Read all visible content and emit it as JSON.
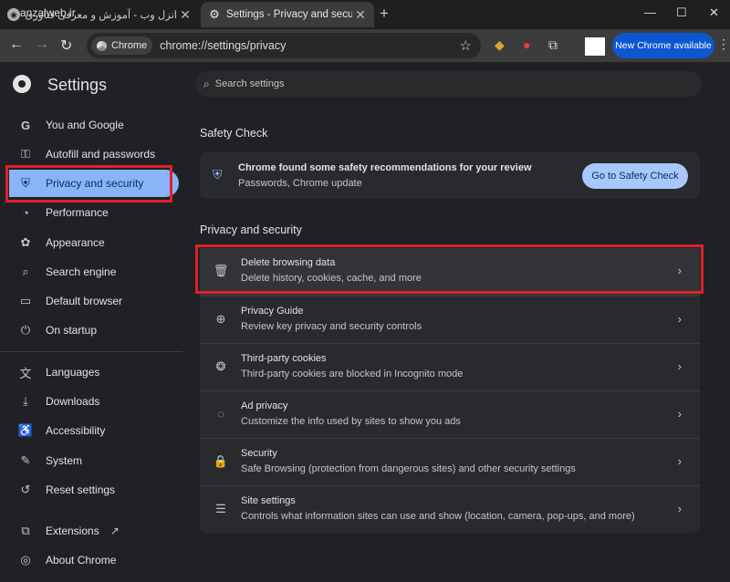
{
  "browser": {
    "tabs": [
      {
        "title": "انزل وب - آموزش و معرفی فناوری",
        "favicon": "globe-icon"
      },
      {
        "title": "Settings - Privacy and security",
        "favicon": "gear-icon"
      }
    ],
    "watermark": "anzalweb.ir",
    "toolbar": {
      "chip_label": "Chrome",
      "url": "chrome://settings/privacy",
      "update_label": "New Chrome available"
    }
  },
  "sidebar": {
    "title": "Settings",
    "items": [
      {
        "label": "You and Google",
        "icon": "google-g-icon"
      },
      {
        "label": "Autofill and passwords",
        "icon": "key-icon"
      },
      {
        "label": "Privacy and security",
        "icon": "shield-icon",
        "active": true
      },
      {
        "label": "Performance",
        "icon": "speedometer-icon"
      },
      {
        "label": "Appearance",
        "icon": "palette-icon"
      },
      {
        "label": "Search engine",
        "icon": "search-icon"
      },
      {
        "label": "Default browser",
        "icon": "browser-window-icon"
      },
      {
        "label": "On startup",
        "icon": "power-icon"
      },
      {
        "label": "Languages",
        "icon": "translate-icon"
      },
      {
        "label": "Downloads",
        "icon": "download-icon"
      },
      {
        "label": "Accessibility",
        "icon": "accessibility-icon"
      },
      {
        "label": "System",
        "icon": "wrench-icon"
      },
      {
        "label": "Reset settings",
        "icon": "reset-icon"
      },
      {
        "label": "Extensions",
        "icon": "puzzle-icon"
      },
      {
        "label": "About Chrome",
        "icon": "chrome-icon"
      }
    ]
  },
  "search": {
    "placeholder": "Search settings"
  },
  "safety_check": {
    "heading": "Safety Check",
    "title": "Chrome found some safety recommendations for your review",
    "subtitle": "Passwords, Chrome update",
    "button": "Go to Safety Check"
  },
  "privacy": {
    "heading": "Privacy and security",
    "rows": [
      {
        "title": "Delete browsing data",
        "subtitle": "Delete history, cookies, cache, and more",
        "icon": "trash-icon"
      },
      {
        "title": "Privacy Guide",
        "subtitle": "Review key privacy and security controls",
        "icon": "compass-icon"
      },
      {
        "title": "Third-party cookies",
        "subtitle": "Third-party cookies are blocked in Incognito mode",
        "icon": "cookie-icon"
      },
      {
        "title": "Ad privacy",
        "subtitle": "Customize the info used by sites to show you ads",
        "icon": "ad-privacy-icon"
      },
      {
        "title": "Security",
        "subtitle": "Safe Browsing (protection from dangerous sites) and other security settings",
        "icon": "lock-icon"
      },
      {
        "title": "Site settings",
        "subtitle": "Controls what information sites can use and show (location, camera, pop-ups, and more)",
        "icon": "sliders-icon"
      }
    ]
  },
  "colors": {
    "accent": "#8ab4f8",
    "highlight": "#e0202a",
    "background": "#202124"
  }
}
